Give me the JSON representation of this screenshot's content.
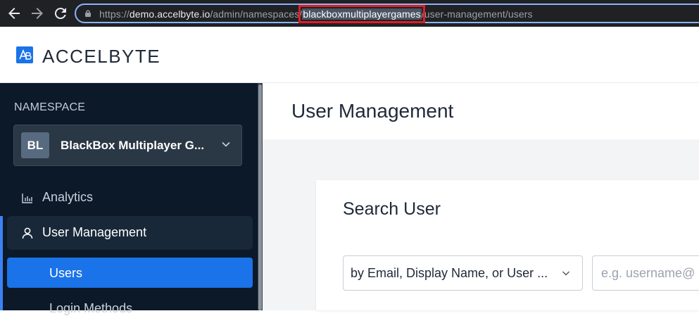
{
  "browser": {
    "url_prefix": "https://",
    "url_host": "demo.accelbyte.io",
    "url_path_before": "/admin/namespaces/",
    "url_highlight": "blackboxmultiplayergames",
    "url_path_after": "/user-management/users",
    "icons": {
      "back": "arrow-left-icon",
      "forward": "arrow-right-icon",
      "reload": "reload-icon",
      "lock": "lock-icon"
    }
  },
  "header": {
    "logo_text": "ACCELBYTE"
  },
  "sidebar": {
    "namespace_label": "NAMESPACE",
    "namespace": {
      "avatar": "BL",
      "name": "BlackBox Multiplayer G..."
    },
    "items": [
      {
        "label": "Analytics",
        "icon": "bar-chart-icon"
      },
      {
        "label": "User Management",
        "icon": "user-icon",
        "active": true
      }
    ],
    "sub_items": [
      {
        "label": "Users",
        "active": true
      },
      {
        "label": "Login Methods"
      }
    ]
  },
  "main": {
    "page_title": "User Management",
    "card_title": "Search User",
    "filter_label": "by Email, Display Name, or User ...",
    "search_placeholder": "e.g. username@"
  },
  "colors": {
    "accent": "#1a73e8",
    "sidebar_bg": "#0b1929",
    "highlight_box": "#e01d24"
  }
}
